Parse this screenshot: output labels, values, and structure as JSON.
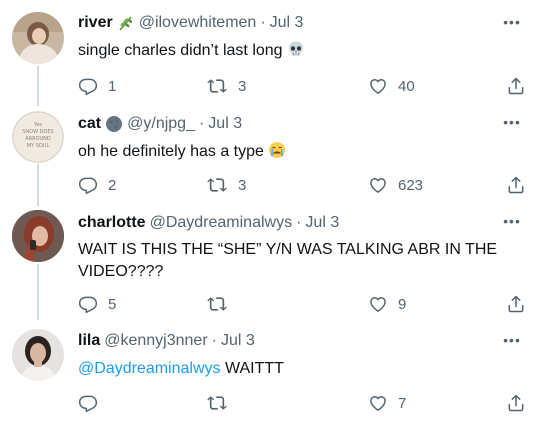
{
  "tweets": [
    {
      "name": "river",
      "badge_icon": "herb-emoji",
      "handle": "@ilovewhitemen",
      "dot": "·",
      "time": "Jul 3",
      "text": "single charles didn’t last long",
      "text_emoji": "skull-emoji",
      "replies": "1",
      "retweets": "3",
      "likes": "40"
    },
    {
      "name": "cat",
      "badge_icon": "moon-emoji",
      "handle": "@y/njpg_",
      "dot": "·",
      "time": "Jul 3",
      "text": "oh he definitely has a type",
      "text_emoji": "crying-face-emoji",
      "avatar_text": "Yes SNOW DOES ARROUND MY SOUL",
      "replies": "2",
      "retweets": "3",
      "likes": "623"
    },
    {
      "name": "charlotte",
      "handle": "@Daydreaminalwys",
      "dot": "·",
      "time": "Jul 3",
      "text": "WAIT IS THIS THE “SHE” Y/N WAS TALKING ABR IN THE VIDEO????",
      "replies": "5",
      "retweets": "",
      "likes": "9"
    },
    {
      "name": "lila",
      "handle": "@kennyj3nner",
      "dot": "·",
      "time": "Jul 3",
      "mention": "@Daydreaminalwys",
      "text": "WAITTT",
      "replies": "",
      "retweets": "",
      "likes": "7"
    }
  ],
  "more_label": "•••",
  "colors": {
    "text": "#0f1419",
    "secondary": "#536471",
    "link": "#1d9bf0",
    "thread_line": "#cfd9de"
  }
}
